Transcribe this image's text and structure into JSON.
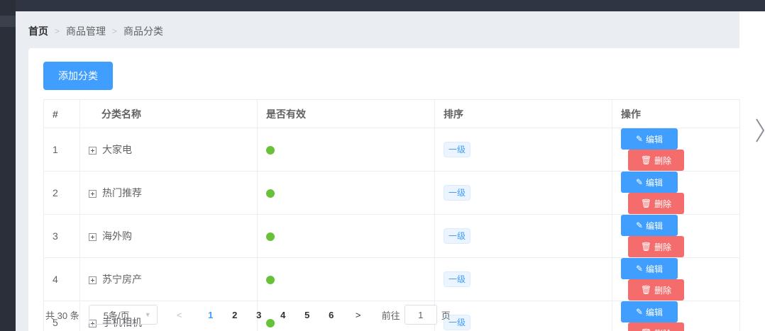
{
  "breadcrumb": [
    "首页",
    "商品管理",
    "商品分类"
  ],
  "add_button": "添加分类",
  "table": {
    "headers": [
      "#",
      "分类名称",
      "是否有效",
      "排序",
      "操作"
    ],
    "rows": [
      {
        "index": "1",
        "name": "大家电",
        "level": "一级"
      },
      {
        "index": "2",
        "name": "热门推荐",
        "level": "一级"
      },
      {
        "index": "3",
        "name": "海外购",
        "level": "一级"
      },
      {
        "index": "4",
        "name": "苏宁房产",
        "level": "一级"
      },
      {
        "index": "5",
        "name": "手机相机",
        "level": "一级"
      }
    ],
    "edit_label": "编辑",
    "delete_label": "删除"
  },
  "pagination": {
    "total": "共 30 条",
    "page_size": "5条/页",
    "pages": [
      "1",
      "2",
      "3",
      "4",
      "5",
      "6"
    ],
    "current": "1",
    "goto_prefix": "前往",
    "goto_value": "1",
    "goto_suffix": "页"
  },
  "colors": {
    "primary": "#409eff",
    "danger": "#f56c6c",
    "success": "#67c23a"
  }
}
